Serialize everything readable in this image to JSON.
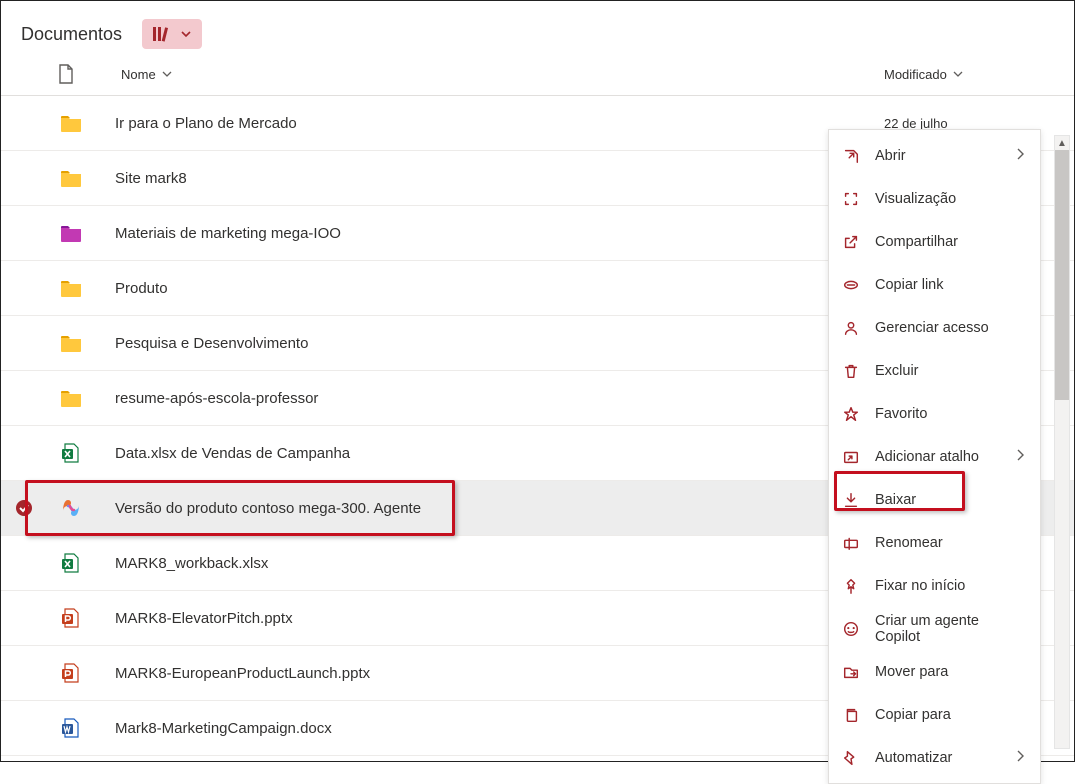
{
  "header": {
    "title": "Documentos"
  },
  "columns": {
    "name": "Nome",
    "modified": "Modificado"
  },
  "rows": [
    {
      "icon": "folder-yellow",
      "name": "Ir para o Plano de Mercado",
      "modified": "22 de julho",
      "selected": false
    },
    {
      "icon": "folder-yellow",
      "name": "Site mark8",
      "modified": "",
      "selected": false
    },
    {
      "icon": "folder-magenta",
      "name": "Materiais de marketing mega-IOO",
      "modified": "",
      "selected": false
    },
    {
      "icon": "folder-yellow",
      "name": "Produto",
      "modified": "",
      "selected": false
    },
    {
      "icon": "folder-yellow",
      "name": "Pesquisa e Desenvolvimento",
      "modified": "",
      "selected": false
    },
    {
      "icon": "folder-yellow",
      "name": "resume-após-escola-professor",
      "modified": "",
      "selected": false
    },
    {
      "icon": "excel",
      "name": "Data.xlsx de Vendas de Campanha",
      "modified": "",
      "selected": false
    },
    {
      "icon": "copilot",
      "name": "Versão do produto contoso mega-300. Agente",
      "modified": "",
      "selected": true
    },
    {
      "icon": "excel",
      "name": "MARK8_workback.xlsx",
      "modified": "",
      "selected": false
    },
    {
      "icon": "powerpoint",
      "name": "MARK8-ElevatorPitch.pptx",
      "modified": "",
      "selected": false
    },
    {
      "icon": "powerpoint",
      "name": "MARK8-EuropeanProductLaunch.pptx",
      "modified": "",
      "selected": false
    },
    {
      "icon": "word",
      "name": "Mark8-MarketingCampaign.docx",
      "modified": "",
      "selected": false
    }
  ],
  "context_menu": [
    {
      "icon": "open",
      "label": "Abrir",
      "arrow": true
    },
    {
      "icon": "preview",
      "label": "Visualização",
      "arrow": false
    },
    {
      "icon": "share",
      "label": "Compartilhar",
      "arrow": false
    },
    {
      "icon": "link",
      "label": "Copiar link",
      "arrow": false
    },
    {
      "icon": "access",
      "label": "Gerenciar acesso",
      "arrow": false
    },
    {
      "icon": "delete",
      "label": "Excluir",
      "arrow": false
    },
    {
      "icon": "favorite",
      "label": "Favorito",
      "arrow": false
    },
    {
      "icon": "shortcut",
      "label": "Adicionar atalho",
      "arrow": true
    },
    {
      "icon": "download",
      "label": "Baixar",
      "arrow": false
    },
    {
      "icon": "rename",
      "label": "Renomear",
      "arrow": false
    },
    {
      "icon": "pin",
      "label": "Fixar no início",
      "arrow": false
    },
    {
      "icon": "copilot-new",
      "label": "Criar um agente Copilot",
      "arrow": false
    },
    {
      "icon": "move",
      "label": "Mover para",
      "arrow": false
    },
    {
      "icon": "copy",
      "label": "Copiar para",
      "arrow": false
    },
    {
      "icon": "automate",
      "label": "Automatizar",
      "arrow": true
    }
  ]
}
